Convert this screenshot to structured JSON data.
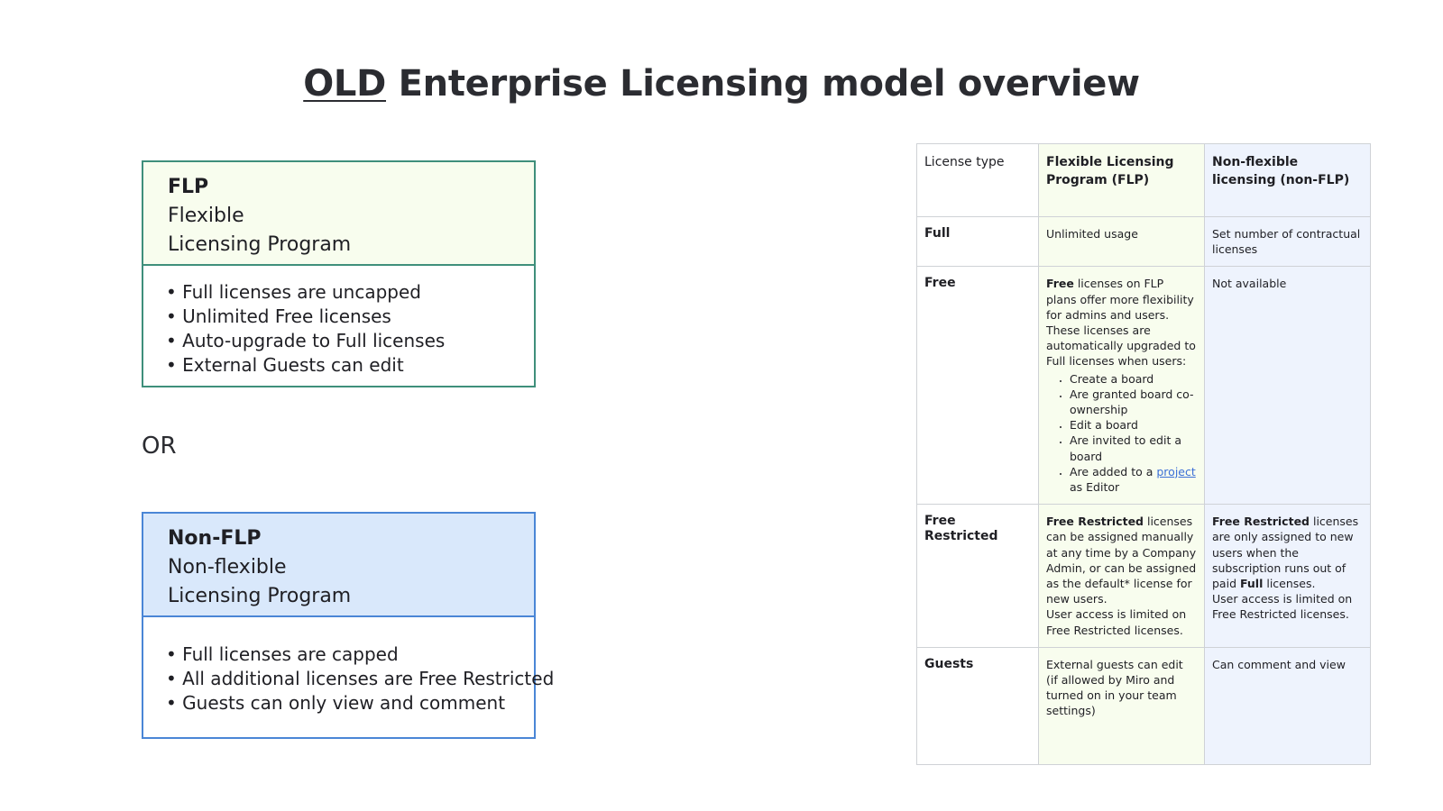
{
  "title": {
    "underlined": "OLD",
    "rest": "Enterprise Licensing model overview"
  },
  "flp_card": {
    "abbr": "FLP",
    "line1": "Flexible",
    "line2": "Licensing Program",
    "bullets": [
      "• Full licenses are uncapped",
      "• Unlimited Free licenses",
      "• Auto-upgrade to Full licenses",
      "• External Guests can edit"
    ]
  },
  "or_label": "OR",
  "nonflp_card": {
    "abbr": "Non-FLP",
    "line1": "Non-flexible",
    "line2": "Licensing Program",
    "bullets": [
      "• Full licenses are capped",
      "• All additional licenses are Free Restricted",
      "• Guests can only view and comment"
    ]
  },
  "table": {
    "header": {
      "c1": "License type",
      "c2": "Flexible Licensing Program (FLP)",
      "c3": "Non-flexible licensing (non-FLP)"
    },
    "full": {
      "label": "Full",
      "flp": "Unlimited usage",
      "nonflp": "Set number of contractual licenses"
    },
    "free": {
      "label": "Free",
      "flp_bold": "Free",
      "flp_text": " licenses on FLP plans offer more flexibility for admins and users. These licenses are automatically upgraded to Full licenses when users:",
      "flp_list": [
        "Create a board",
        "Are granted board co-ownership",
        "Edit a board",
        "Are invited to edit a board"
      ],
      "flp_last_pre": "Are added to a ",
      "flp_last_link": "project",
      "flp_last_post": " as Editor",
      "nonflp": "Not available"
    },
    "free_restricted": {
      "label": "Free Restricted",
      "flp_bold": "Free Restricted",
      "flp_text": " licenses can be assigned manually at any time by a Company Admin, or can be assigned as the default* license for new users.",
      "flp_text2": "User access is limited on Free Restricted licenses.",
      "nonflp_bold": "Free Restricted",
      "nonflp_text": " licenses are only assigned to new users when the subscription runs out of paid ",
      "nonflp_bold2": "Full",
      "nonflp_text2": " licenses.",
      "nonflp_text3": "User access is limited on Free Restricted licenses."
    },
    "guests": {
      "label": "Guests",
      "flp": "External guests can edit (if allowed by Miro and turned on in your team settings)",
      "nonflp": "Can comment and view"
    }
  },
  "colors": {
    "flp_border": "#3f8f7b",
    "flp_fill": "#f8fdee",
    "nonflp_border": "#4a86d6",
    "nonflp_fill": "#d9e8fb",
    "table_nonflp_fill": "#eef3fd",
    "link": "#3b6fd6"
  }
}
